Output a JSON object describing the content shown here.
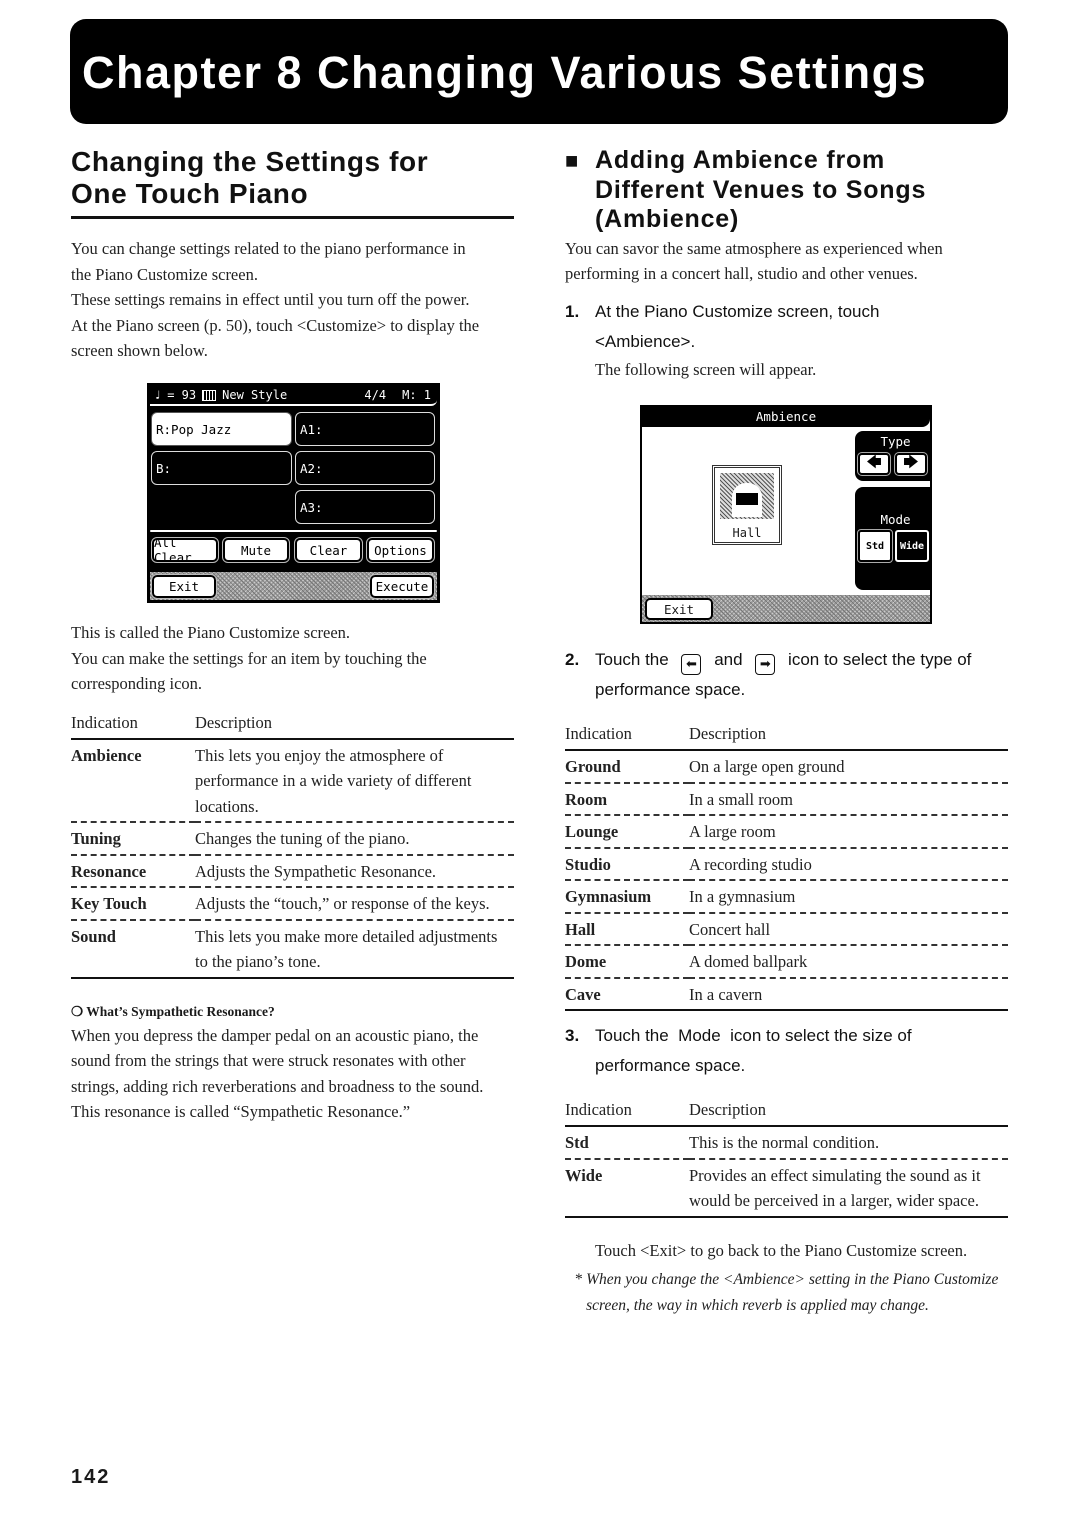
{
  "chapter": {
    "title": "Chapter 8 Changing Various Settings"
  },
  "left": {
    "section_title_line1": "Changing the Settings for",
    "section_title_line2": "One Touch Piano",
    "intro_lines": [
      "You can change settings related to the piano performance in",
      "the Piano Customize screen.",
      "These settings remains in effect until you turn off the power.",
      "At the Piano screen (p. 50), touch <Customize> to display the",
      "screen shown below."
    ],
    "screen": {
      "tempo_icon": "quarter-note-icon",
      "tempo": "= 93",
      "style_label": "New Style",
      "time_sig": "4/4",
      "measure": "M:   1",
      "cells": {
        "r": "R:Pop Jazz",
        "a1": "A1:",
        "b": "B:",
        "a2": "A2:",
        "a3": "A3:"
      },
      "buttons": {
        "all_clear": "All Clear",
        "mute": "Mute",
        "clear": "Clear",
        "options": "Options",
        "exit": "Exit",
        "execute": "Execute"
      }
    },
    "after_screen_lines": [
      "This is called the Piano Customize screen.",
      "You can make the settings for an item by touching the",
      "corresponding icon."
    ],
    "table": {
      "headers": [
        "Indication",
        "Description"
      ],
      "rows": [
        {
          "ind": "Ambience",
          "desc": "This lets you enjoy the atmosphere of performance in a wide variety of different locations."
        },
        {
          "ind": "Tuning",
          "desc": "Changes the tuning of the piano."
        },
        {
          "ind": "Resonance",
          "desc": "Adjusts the Sympathetic Resonance."
        },
        {
          "ind": "Key Touch",
          "desc": "Adjusts the “touch,” or response of the keys."
        },
        {
          "ind": "Sound",
          "desc": "This lets you make more detailed adjustments to the piano’s tone."
        }
      ]
    },
    "note_title": "What’s Sympathetic Resonance?",
    "note_bullet": "❍",
    "note_text": "When you depress the damper pedal on an acoustic piano, the sound from the strings that were struck resonates with other strings, adding rich reverberations and broadness to the sound. This resonance is called “Sympathetic Resonance.”"
  },
  "right": {
    "section_bullet": "■",
    "section_title_lines": [
      "Adding Ambience from",
      "Different Venues to Songs",
      "(Ambience)"
    ],
    "intro": "You can savor the same atmosphere as experienced when performing in a concert hall, studio and other venues.",
    "step1": {
      "num": "1.",
      "text_line1": "At the Piano Customize screen, touch",
      "text_line2": "<Ambience>.",
      "sub": "The following screen will appear."
    },
    "screen": {
      "title": "Ambience",
      "type_label": "Type",
      "mode_label": "Mode",
      "venue_label": "Hall",
      "left_arrow": "🡄",
      "right_arrow": "🡆",
      "std": "Std",
      "wide": "Wide",
      "exit": "Exit"
    },
    "step2": {
      "num": "2.",
      "pre": "Touch the",
      "mid": "and",
      "post": "icon to select the type of",
      "line2": "performance space.",
      "left_icon": "⬅",
      "right_icon": "➡"
    },
    "venue_table": {
      "headers": [
        "Indication",
        "Description"
      ],
      "rows": [
        {
          "ind": "Ground",
          "desc": "On a large open ground"
        },
        {
          "ind": "Room",
          "desc": "In a small room"
        },
        {
          "ind": "Lounge",
          "desc": "A large room"
        },
        {
          "ind": "Studio",
          "desc": "A recording studio"
        },
        {
          "ind": "Gymnasium",
          "desc": "In a gymnasium"
        },
        {
          "ind": "Hall",
          "desc": "Concert hall"
        },
        {
          "ind": "Dome",
          "desc": "A domed ballpark"
        },
        {
          "ind": "Cave",
          "desc": "In a cavern"
        }
      ]
    },
    "step3": {
      "num": "3.",
      "line1": "Touch the  Mode  icon to select the size of",
      "line2": "performance space."
    },
    "mode_table": {
      "headers": [
        "Indication",
        "Description"
      ],
      "rows": [
        {
          "ind": "Std",
          "desc": "This is the normal condition."
        },
        {
          "ind": "Wide",
          "desc": "Provides an effect simulating the sound as it would be perceived in a larger, wider space."
        }
      ]
    },
    "exit_text": "Touch <Exit> to go back to the Piano Customize screen.",
    "footnote_mark": "*",
    "footnote": "When you change the <Ambience> setting in the Piano Customize screen, the way in which reverb is applied may change."
  },
  "page_number": "142"
}
